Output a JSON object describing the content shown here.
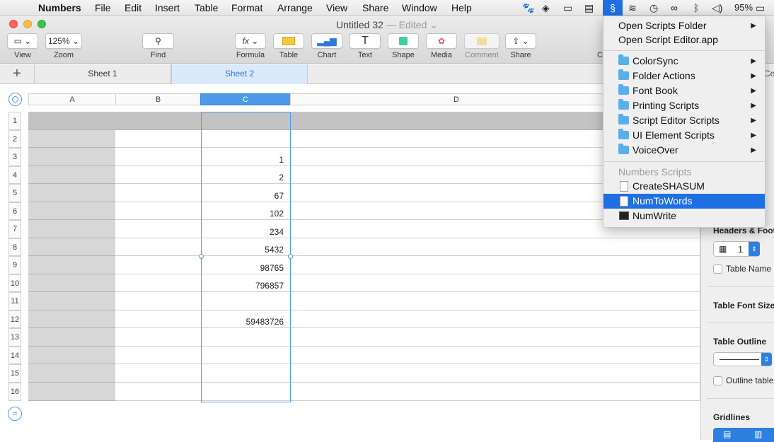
{
  "menubar": {
    "apple": "",
    "items": [
      "Numbers",
      "File",
      "Edit",
      "Insert",
      "Table",
      "Format",
      "Arrange",
      "View",
      "Share",
      "Window",
      "Help"
    ],
    "battery": "95%"
  },
  "window": {
    "title": "Untitled 32",
    "edited": "— Edited",
    "zoom": "125%"
  },
  "toolbar": {
    "view": "View",
    "zoom": "Zoom",
    "find": "Find",
    "formula": "Formula",
    "table": "Table",
    "chart": "Chart",
    "text": "Text",
    "shape": "Shape",
    "media": "Media",
    "comment": "Comment",
    "share": "Share",
    "format_partial": "C",
    "fx": "fx",
    "text_icon": "T"
  },
  "sheets": [
    "Sheet 1",
    "Sheet 2"
  ],
  "add_sheet": "+",
  "grid": {
    "columns": [
      "A",
      "B",
      "C",
      "D"
    ],
    "rows": [
      "1",
      "2",
      "3",
      "4",
      "5",
      "6",
      "7",
      "8",
      "9",
      "10",
      "11",
      "12",
      "13",
      "14",
      "15",
      "16"
    ],
    "c_values": [
      "",
      "",
      "1",
      "2",
      "67",
      "102",
      "234",
      "5432",
      "98765",
      "796857",
      "",
      "59483726",
      "",
      "",
      "",
      ""
    ],
    "add_row": "="
  },
  "script_menu": {
    "top": [
      "Open Scripts Folder",
      "Open Script Editor.app"
    ],
    "folders": [
      "ColorSync",
      "Folder Actions",
      "Font Book",
      "Printing Scripts",
      "Script Editor Scripts",
      "UI Element Scripts",
      "VoiceOver"
    ],
    "section": "Numbers Scripts",
    "scripts": [
      "CreateSHASUM",
      "NumToWords",
      "NumWrite"
    ],
    "selected": "NumToWords",
    "arrow": "▶"
  },
  "inspector": {
    "tab_partial": "Ce",
    "headers_footers": "Headers & Foot",
    "header_rows": "1",
    "table_name": "Table Name",
    "font_size": "Table Font Size",
    "outline": "Table Outline",
    "outline_table": "Outline table",
    "gridlines": "Gridlines"
  },
  "colors": {
    "accent": "#1e6fe4",
    "selection": "#58a6ee",
    "header_row": "#c3c3c3",
    "header_col": "#d7d7d7"
  }
}
